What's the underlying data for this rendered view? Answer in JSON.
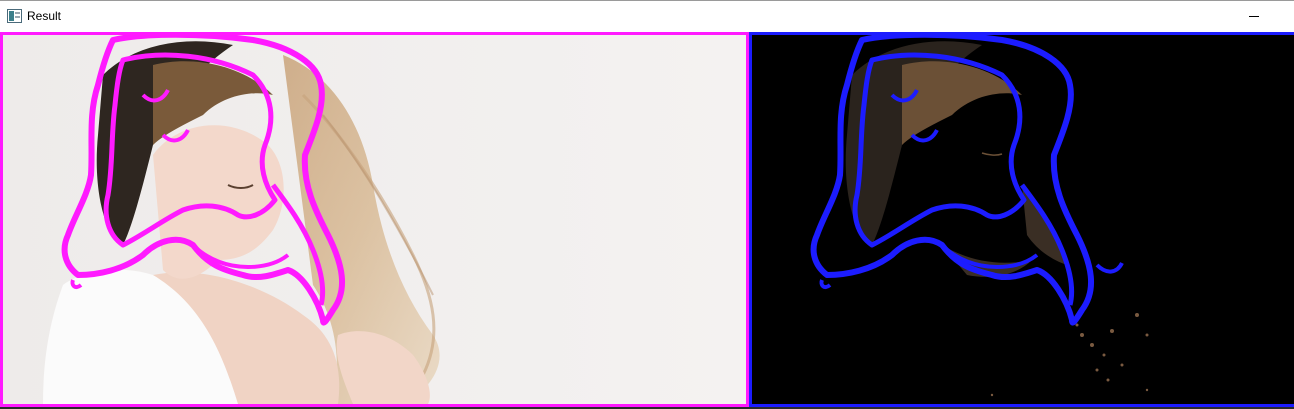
{
  "window": {
    "title": "Result",
    "controls": {
      "minimize_icon": "minimize-icon"
    }
  },
  "colors": {
    "original_contour": "#ff1aff",
    "result_contour": "#1c1cff",
    "background": "#000000",
    "titlebar": "#ffffff"
  },
  "panels": [
    {
      "id": "original-image-with-contours",
      "border_color": "#ff1aff"
    },
    {
      "id": "masked-result-with-contours",
      "border_color": "#1c1cff"
    }
  ]
}
